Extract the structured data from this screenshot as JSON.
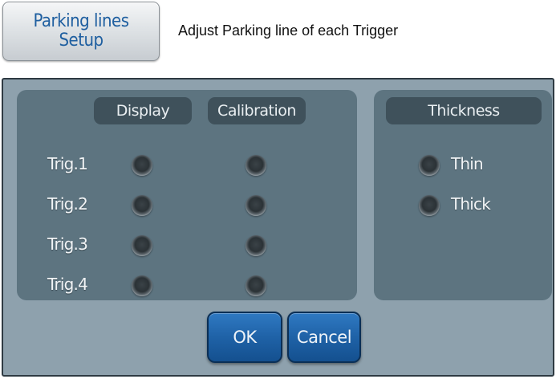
{
  "header": {
    "button_line1": "Parking lines",
    "button_line2": "Setup",
    "description": "Adjust Parking line of each Trigger"
  },
  "columns": {
    "display": "Display",
    "calibration": "Calibration",
    "thickness": "Thickness"
  },
  "triggers": [
    {
      "label": "Trig.1"
    },
    {
      "label": "Trig.2"
    },
    {
      "label": "Trig.3"
    },
    {
      "label": "Trig.4"
    }
  ],
  "thickness_options": [
    {
      "label": "Thin"
    },
    {
      "label": "Thick"
    }
  ],
  "buttons": {
    "ok": "OK",
    "cancel": "Cancel"
  }
}
